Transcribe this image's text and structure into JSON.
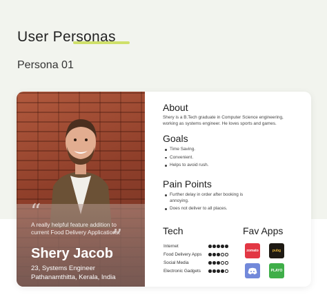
{
  "header": {
    "title": "User Personas",
    "subtitle": "Persona 01"
  },
  "persona": {
    "quote": "A really helpful feature addition to current Food Delivery Applications.",
    "name": "Shery Jacob",
    "age_role": "23, Systems Engineer",
    "location": "Pathanamthitta, Kerala, India"
  },
  "about": {
    "heading": "About",
    "text": "Shery is a B.Tech graduate in Computer Science engineering, working as systems engineer. He loves sports and games."
  },
  "goals": {
    "heading": "Goals",
    "items": [
      "Time Saving.",
      "Convenient.",
      "Helps to avoid rush."
    ]
  },
  "pain_points": {
    "heading": "Pain Points",
    "items": [
      "Further delay in order after booking is annoying.",
      "Does not deliver to all places."
    ]
  },
  "tech": {
    "heading": "Tech",
    "rows": [
      {
        "label": "Internet",
        "level": 5
      },
      {
        "label": "Food Delivery Apps",
        "level": 3
      },
      {
        "label": "Social Media",
        "level": 3
      },
      {
        "label": "Electronic Gadgets",
        "level": 4
      }
    ],
    "max_level": 5
  },
  "fav_apps": {
    "heading": "Fav Apps",
    "apps": [
      {
        "name": "zomato",
        "icon": "zomato-icon",
        "color": "#e23744"
      },
      {
        "name": "pubg",
        "icon": "pubg-icon",
        "color": "#1e1a14"
      },
      {
        "name": "discord",
        "icon": "discord-icon",
        "color": "#7289da"
      },
      {
        "name": "PLAYO",
        "icon": "playo-icon",
        "color": "#3fae49"
      }
    ]
  },
  "colors": {
    "accent_underline": "#cfe06a",
    "background": "#f2f4ee"
  }
}
